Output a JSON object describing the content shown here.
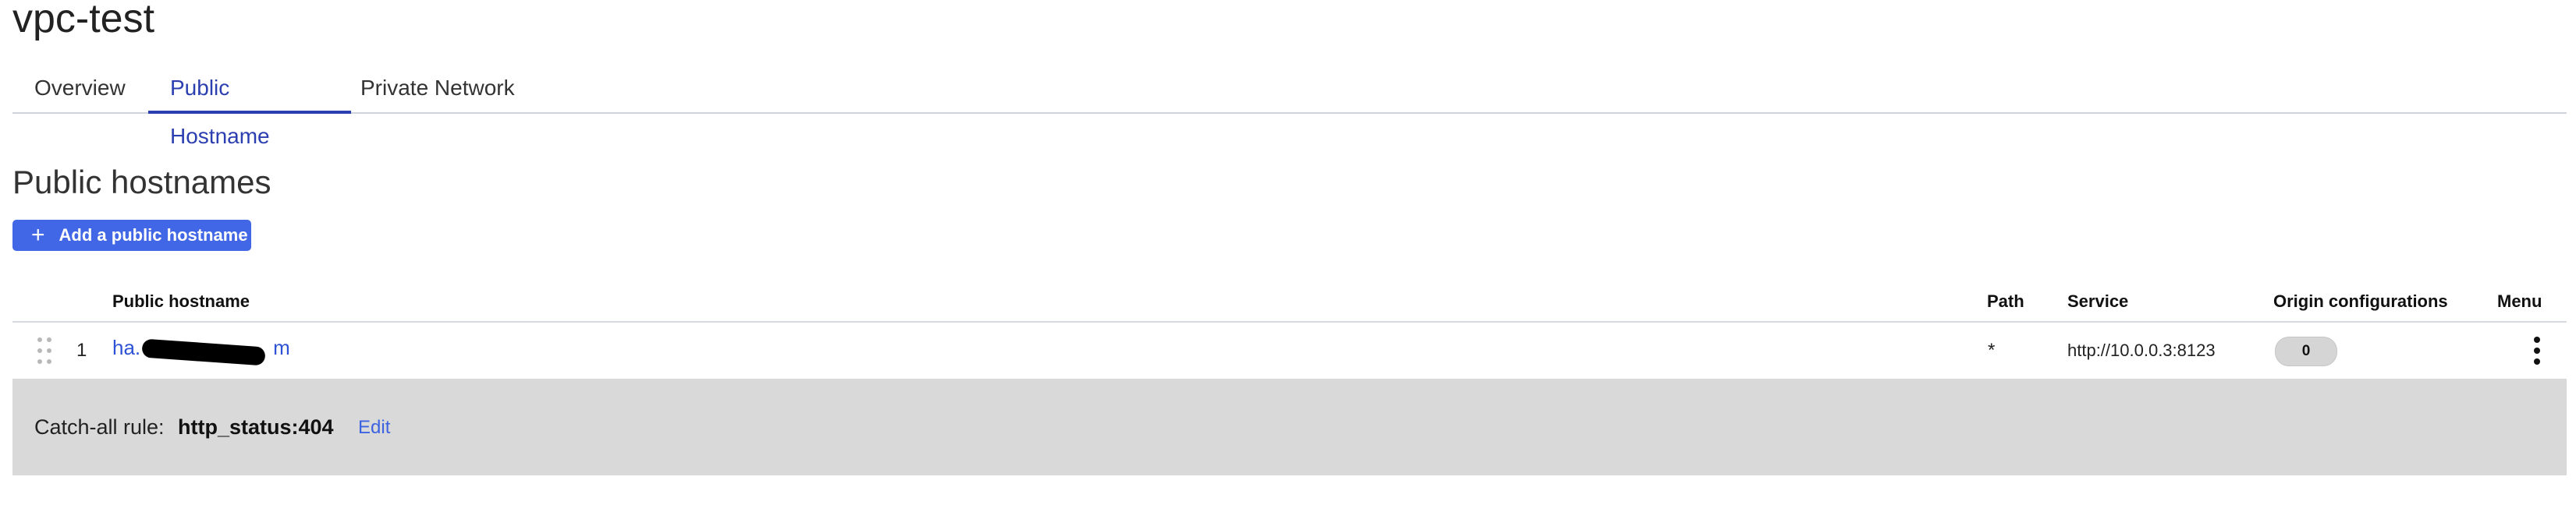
{
  "page": {
    "title": "vpc-test"
  },
  "tabs": [
    {
      "label": "Overview",
      "active": false
    },
    {
      "label": "Public Hostname",
      "active": true
    },
    {
      "label": "Private Network",
      "active": false
    }
  ],
  "section": {
    "title": "Public hostnames",
    "add_button_label": "Add a public hostname"
  },
  "table": {
    "headers": {
      "hostname": "Public hostname",
      "path": "Path",
      "service": "Service",
      "origin": "Origin configurations",
      "menu": "Menu"
    },
    "rows": [
      {
        "index": "1",
        "hostname_prefix": "ha.",
        "hostname_suffix": "m",
        "path": "*",
        "service": "http://10.0.0.3:8123",
        "origin_count": "0"
      }
    ]
  },
  "catch_all": {
    "label": "Catch-all rule:",
    "value": "http_status:404",
    "edit_label": "Edit"
  },
  "colors": {
    "accent": "#4167e6",
    "link": "#2e52d6",
    "active_tab": "#2c3fb0",
    "catch_all_bg": "#d9d9d9"
  },
  "icons": [
    "plus-icon",
    "drag-handle-icon",
    "more-vertical-icon"
  ]
}
